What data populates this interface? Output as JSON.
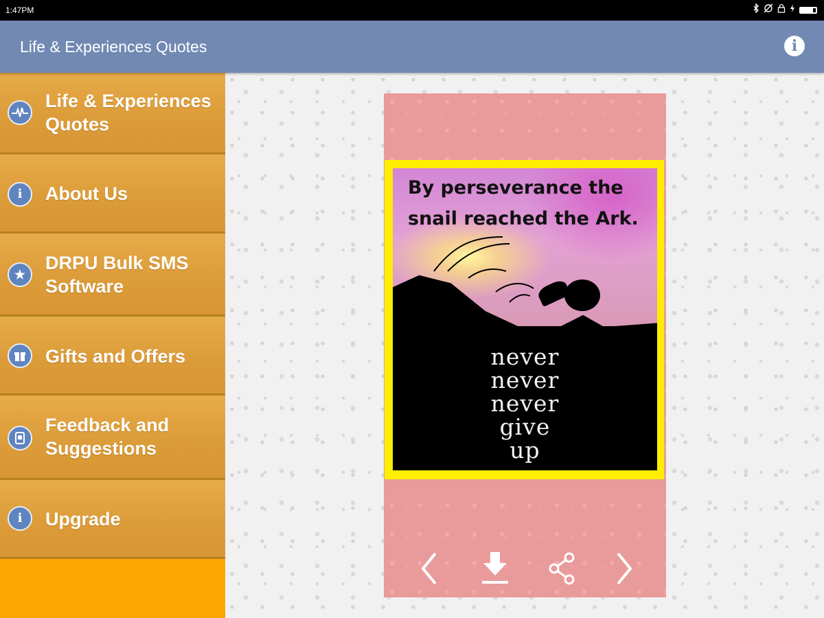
{
  "status_bar": {
    "time": "1:47PM",
    "icons": [
      "bluetooth-icon",
      "sync-off-icon",
      "lock-icon",
      "charging-icon",
      "battery-icon"
    ]
  },
  "app_bar": {
    "title": "Life & Experiences Quotes",
    "info_icon": "info-icon",
    "color": "#7189b3"
  },
  "sidebar": {
    "background": "#fca600",
    "items": [
      {
        "label_line1": "Life & Experiences",
        "label_line2": "Quotes",
        "icon": "pulse-icon"
      },
      {
        "label_line1": "About Us",
        "label_line2": "",
        "icon": "info-icon"
      },
      {
        "label_line1": "DRPU Bulk SMS",
        "label_line2": "Software",
        "icon": "star-icon"
      },
      {
        "label_line1": "Gifts and Offers",
        "label_line2": "",
        "icon": "gift-icon"
      },
      {
        "label_line1": "Feedback and",
        "label_line2": "Suggestions",
        "icon": "feedback-icon"
      },
      {
        "label_line1": "Upgrade",
        "label_line2": "",
        "icon": "info-icon"
      }
    ]
  },
  "quote_card": {
    "quote_line1": "By perseverance the",
    "quote_line2": "snail reached the Ark.",
    "image_text": [
      "never",
      "never",
      "never",
      "give",
      "up"
    ],
    "frame_color": "#ffee00",
    "card_color": "#e99a9a",
    "nav": {
      "previous_icon": "chevron-left-icon",
      "download_icon": "download-icon",
      "share_icon": "share-icon",
      "next_icon": "chevron-right-icon"
    }
  }
}
